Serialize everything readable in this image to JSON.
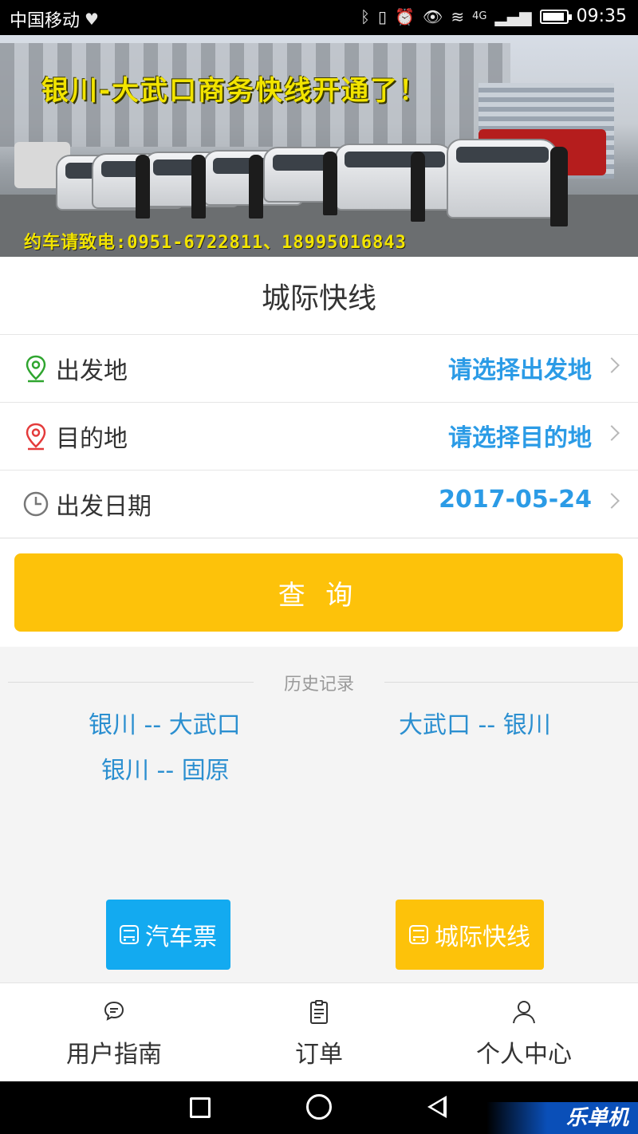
{
  "status_bar": {
    "carrier": "中国移动",
    "network": "4G",
    "time": "09:35"
  },
  "banner": {
    "headline": "银川-大武口商务快线开通了！",
    "phone_line": "约车请致电:0951-6722811、18995016843"
  },
  "page": {
    "title": "城际快线"
  },
  "form": {
    "rows": [
      {
        "label": "出发地",
        "value": "请选择出发地",
        "icon": "location-pin-green-icon"
      },
      {
        "label": "目的地",
        "value": "请选择目的地",
        "icon": "location-pin-red-icon"
      },
      {
        "label": "出发日期",
        "value": "2017-05-24",
        "icon": "clock-icon"
      }
    ],
    "query_button": "查 询"
  },
  "history": {
    "title": "历史记录",
    "items": [
      "银川 -- 大武口",
      "大武口 -- 银川",
      "银川 -- 固原"
    ]
  },
  "categories": [
    {
      "label": "汽车票",
      "color": "#13aaf0"
    },
    {
      "label": "城际快线",
      "color": "#fdc20a"
    }
  ],
  "tabbar": {
    "items": [
      {
        "label": "用户指南",
        "icon": "chat-bubble-icon"
      },
      {
        "label": "订单",
        "icon": "clipboard-icon"
      },
      {
        "label": "个人中心",
        "icon": "person-icon"
      }
    ]
  },
  "watermark": "乐单机",
  "colors": {
    "accent_blue": "#2b9be6",
    "accent_yellow": "#fdc20a",
    "history_blue": "#2b8fd0"
  }
}
